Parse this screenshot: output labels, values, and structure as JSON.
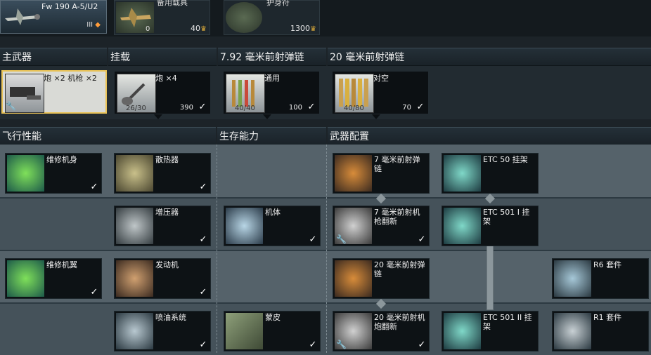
{
  "aircraft": {
    "name": "Fw 190 A-5/U2",
    "rank": "III"
  },
  "top_items": [
    {
      "label": "备用载具",
      "left_num": "0",
      "price": "40"
    },
    {
      "label": "护身符",
      "left_num": "",
      "price": "1300"
    }
  ],
  "sections": {
    "main_weapon": "主武器",
    "payload": "挂载",
    "belt_792": "7.92 毫米前射弹链",
    "belt_20": "20 毫米前射弹链",
    "flight": "飞行性能",
    "survival": "生存能力",
    "weapons_config": "武器配置"
  },
  "weapons": {
    "main": {
      "label": "炮 ×2 机枪 ×2"
    },
    "payload": {
      "label": "炮 ×4",
      "count": "26/30",
      "price": "390"
    },
    "belt1": {
      "label": "通用",
      "count": "40/40",
      "price": "100"
    },
    "belt2": {
      "label": "对空",
      "count": "40/80",
      "price": "70"
    }
  },
  "modules": {
    "fuselage_repair": "维修机身",
    "radiator": "散热器",
    "mg7_belts": "7 毫米前射弹链",
    "etc50": "ETC 50 挂架",
    "compressor": "增压器",
    "airframe": "机体",
    "mg7_new": "7 毫米前射机枪翻新",
    "etc501i": "ETC 501 I 挂架",
    "wing_repair": "维修机翼",
    "engine": "发动机",
    "mm20_belts": "20 毫米前射弹链",
    "r6": "R6 套件",
    "injection": "喷油系统",
    "cover": "蒙皮",
    "mm20_new": "20 毫米前射机炮翻新",
    "etc501ii": "ETC 501 II 挂架",
    "r1": "R1 套件"
  },
  "colors": {
    "accent_gold": "#e9c256",
    "eagle": "#d9a93a"
  },
  "icons": {
    "check": "check-icon",
    "wrench": "wrench-icon",
    "eagle": "eagle-icon"
  }
}
